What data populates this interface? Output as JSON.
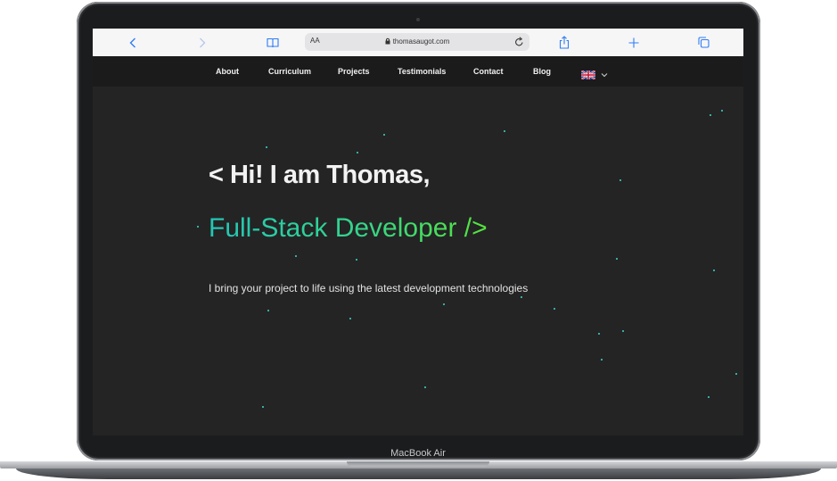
{
  "device": {
    "label": "MacBook Air"
  },
  "browser": {
    "text_size_label": "AA",
    "url": "thomasaugot.com",
    "icons": [
      "chevron-left-icon",
      "chevron-right-icon",
      "book-icon",
      "lock-icon",
      "reload-icon",
      "share-icon",
      "plus-icon",
      "tabs-icon"
    ]
  },
  "nav": {
    "items": [
      {
        "label": "About"
      },
      {
        "label": "Curriculum"
      },
      {
        "label": "Projects"
      },
      {
        "label": "Testimonials"
      },
      {
        "label": "Contact"
      },
      {
        "label": "Blog"
      }
    ],
    "language_icon": "uk-flag-icon"
  },
  "hero": {
    "greeting": "< Hi! I am Thomas,",
    "role": "Full-Stack Developer />",
    "tagline": "I bring your project to life using the latest development technologies"
  },
  "colors": {
    "background": "#242424",
    "nav_background": "#1b1b1b",
    "accent_start": "#23c6b8",
    "accent_end": "#56e33d",
    "particle": "#3fd6d0",
    "browser_accent": "#2f7cf6"
  }
}
